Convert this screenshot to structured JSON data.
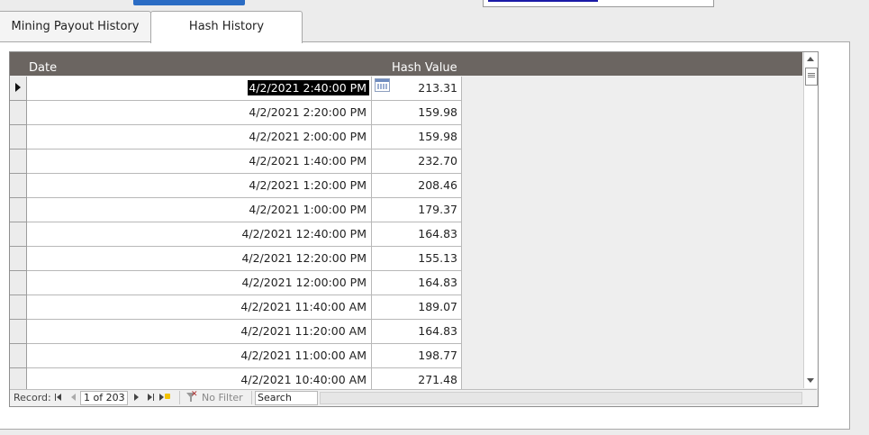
{
  "tabs": [
    {
      "label": "Mining Payout History",
      "active": false
    },
    {
      "label": "Hash History",
      "active": true
    }
  ],
  "grid": {
    "columns": {
      "date": "Date",
      "hash": "Hash Value"
    },
    "rows": [
      {
        "date": "4/2/2021 2:40:00 PM",
        "hash": "213.31"
      },
      {
        "date": "4/2/2021 2:20:00 PM",
        "hash": "159.98"
      },
      {
        "date": "4/2/2021 2:00:00 PM",
        "hash": "159.98"
      },
      {
        "date": "4/2/2021 1:40:00 PM",
        "hash": "232.70"
      },
      {
        "date": "4/2/2021 1:20:00 PM",
        "hash": "208.46"
      },
      {
        "date": "4/2/2021 1:00:00 PM",
        "hash": "179.37"
      },
      {
        "date": "4/2/2021 12:40:00 PM",
        "hash": "164.83"
      },
      {
        "date": "4/2/2021 12:20:00 PM",
        "hash": "155.13"
      },
      {
        "date": "4/2/2021 12:00:00 PM",
        "hash": "164.83"
      },
      {
        "date": "4/2/2021 11:40:00 AM",
        "hash": "189.07"
      },
      {
        "date": "4/2/2021 11:20:00 AM",
        "hash": "164.83"
      },
      {
        "date": "4/2/2021 11:00:00 AM",
        "hash": "198.77"
      },
      {
        "date": "4/2/2021 10:40:00 AM",
        "hash": "271.48"
      }
    ]
  },
  "navigation": {
    "record_label": "Record:",
    "record_position": "1 of 203",
    "filter_label": "No Filter",
    "search_label": "Search"
  },
  "icons": [
    "first-record-icon",
    "previous-record-icon",
    "next-record-icon",
    "last-record-icon",
    "new-record-icon",
    "filter-icon",
    "calendar-icon",
    "scroll-up-icon",
    "scroll-down-icon"
  ]
}
